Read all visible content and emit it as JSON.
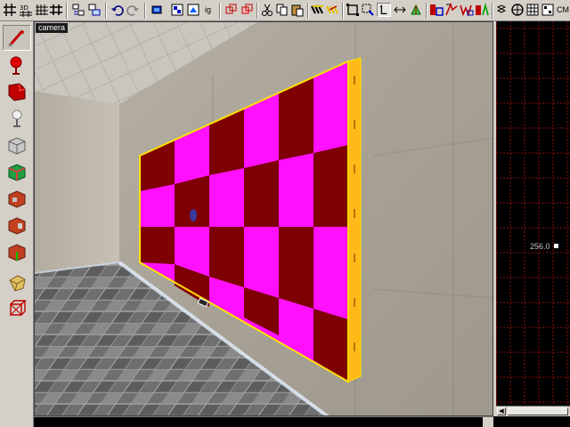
{
  "toolbar": {
    "labels": {
      "ig": "ig",
      "cm": "CM"
    }
  },
  "viewport3d": {
    "label": "camera"
  },
  "viewport2d": {
    "coordinate": "256.0"
  },
  "colors": {
    "checker_light": "#ff10ff",
    "checker_dark": "#7e0000",
    "selection_edge": "#ffc000",
    "grid_line": "#8b1010",
    "grid_major": "#5a0a0a"
  }
}
